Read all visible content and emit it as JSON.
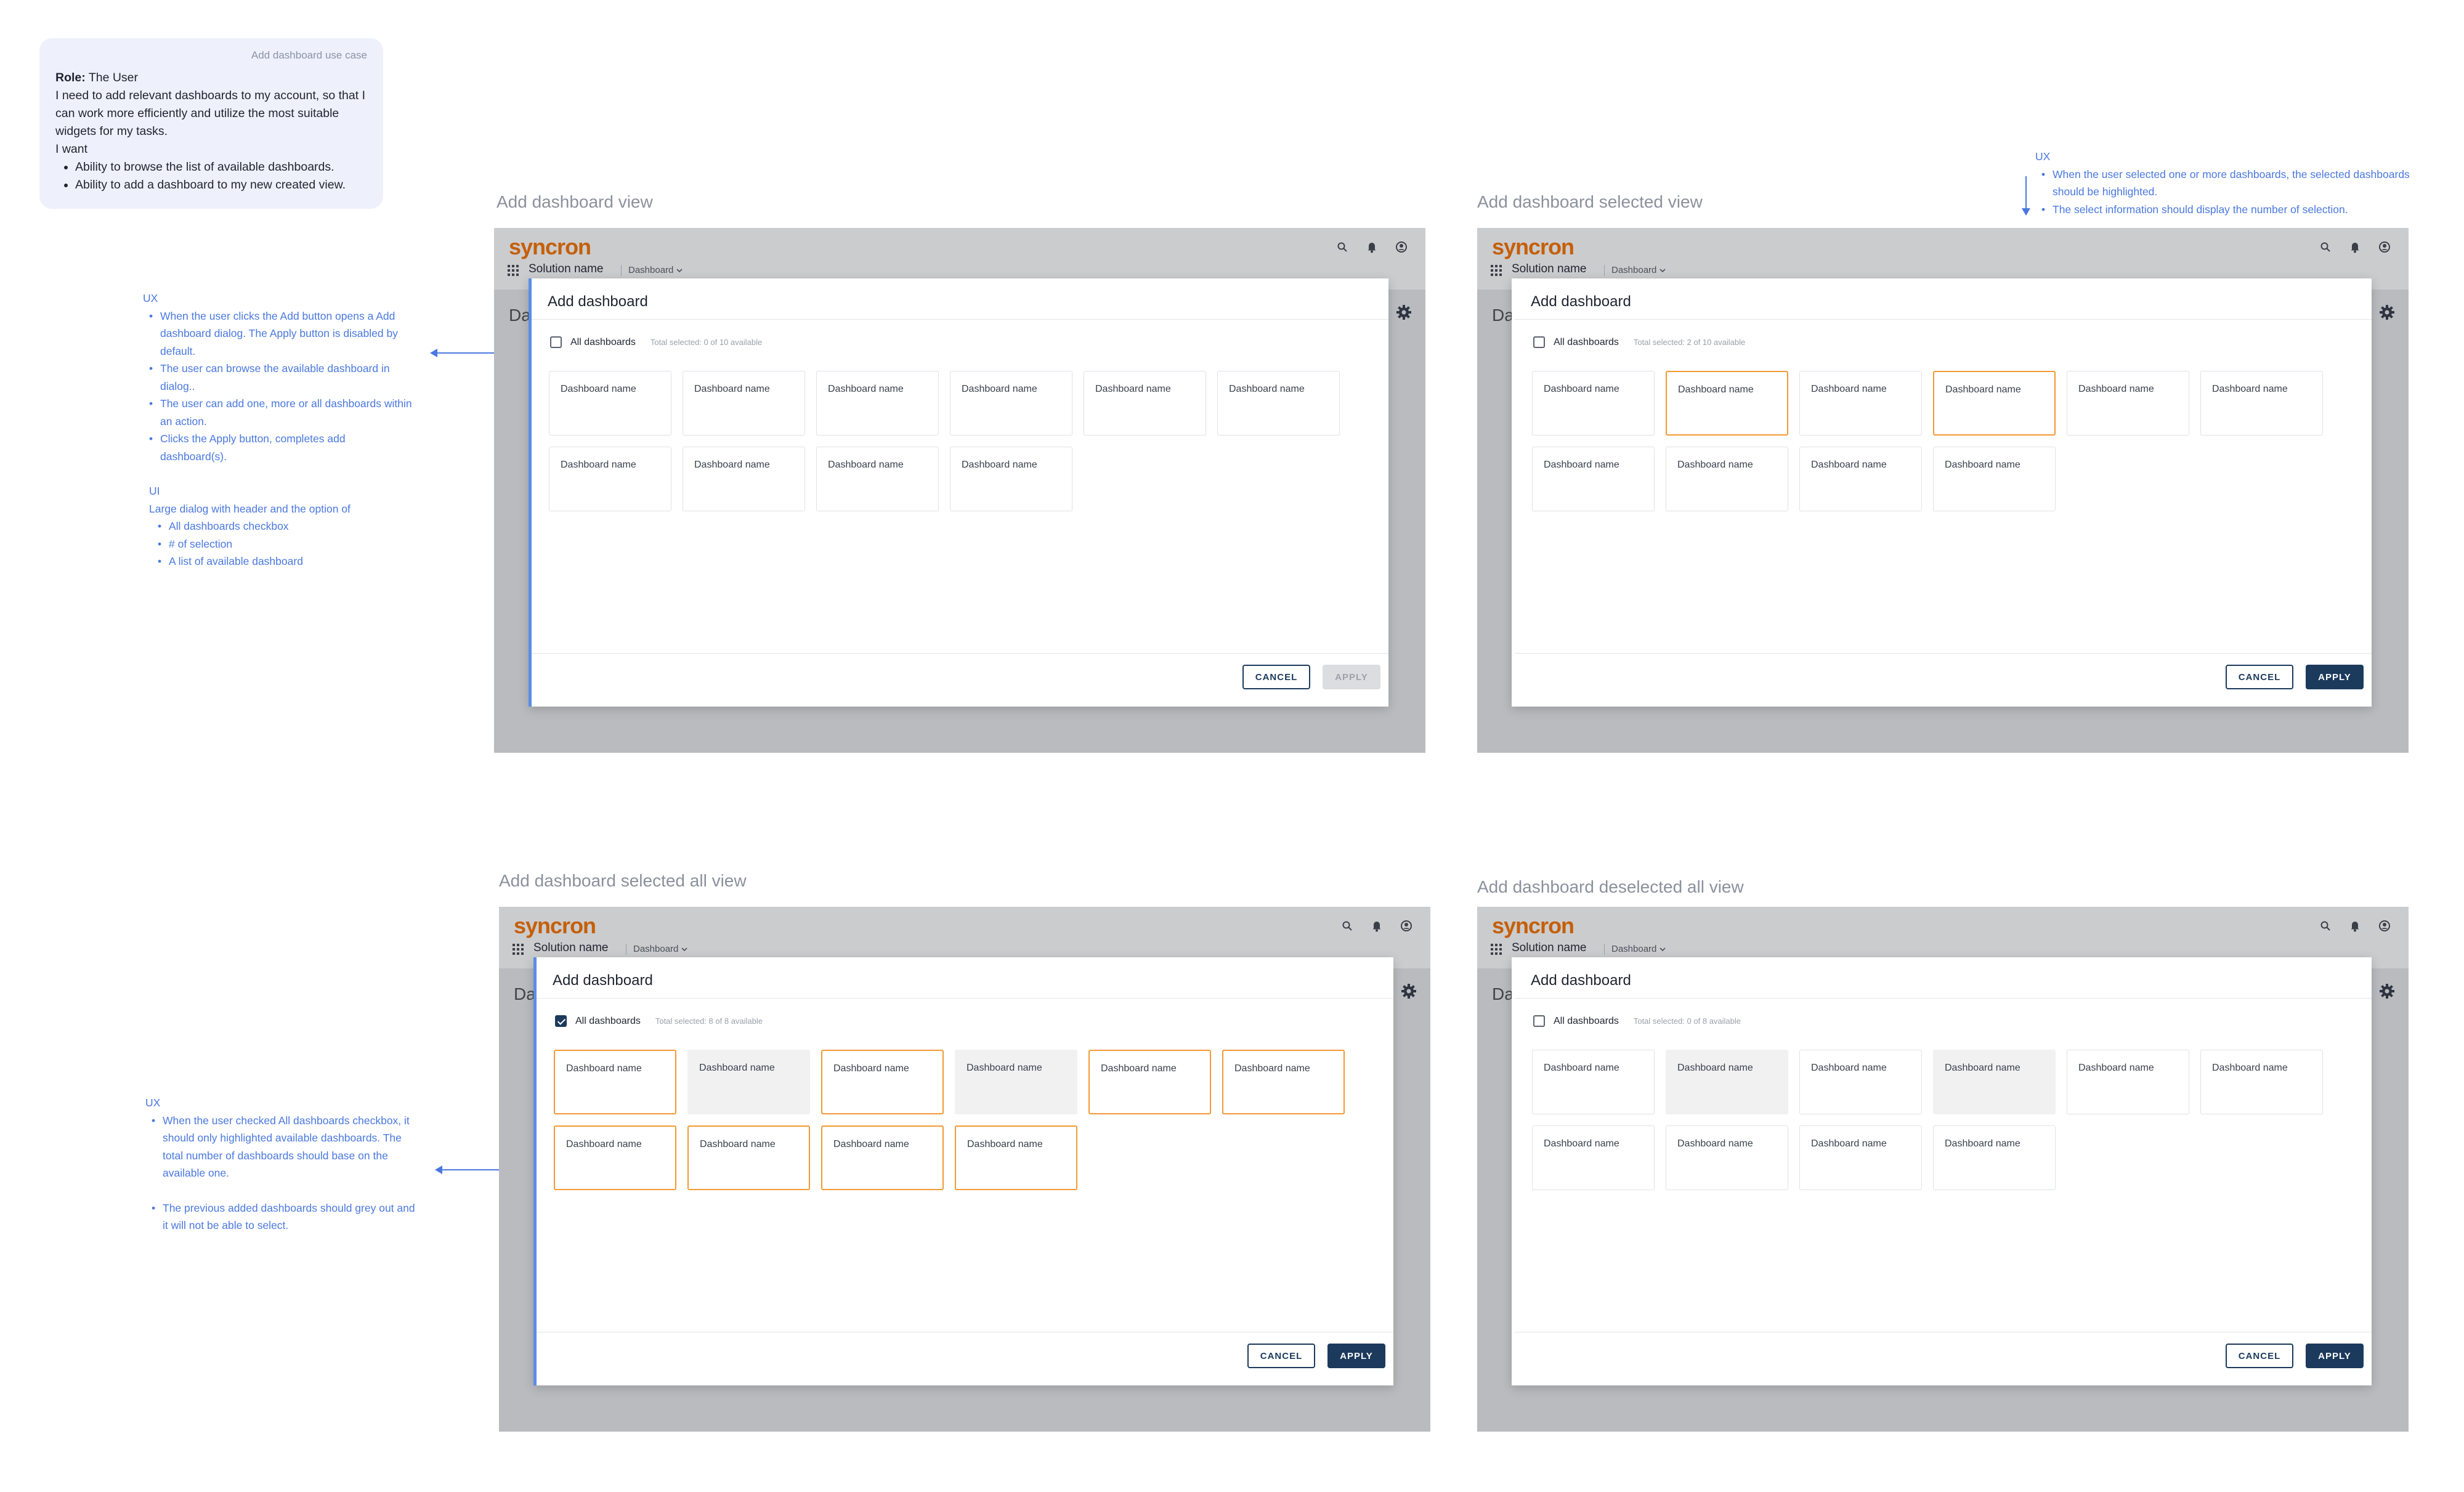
{
  "usecase": {
    "title": "Add dashboard use case",
    "role_label": "Role:",
    "role_value": " The User",
    "need": "I need to add relevant dashboards to my account, so that I can work more efficiently and utilize the most suitable widgets for my tasks.",
    "i_want": "I want",
    "wants": [
      "Ability to browse the list of available dashboards.",
      "Ability to add a dashboard to my new created view."
    ]
  },
  "notes": {
    "note1": {
      "ux_head": "UX",
      "ux_items": [
        "When the user clicks the Add button opens a Add dashboard dialog. The Apply button is disabled by default.",
        "The user can browse the available dashboard in dialog..",
        "The user can add one, more or all dashboards within an action.",
        "Clicks the Apply button, completes add dashboard(s)."
      ],
      "ui_head": "UI",
      "ui_text": "Large dialog with header and the option of",
      "ui_items": [
        "All dashboards checkbox",
        "# of selection",
        "A list of available dashboard"
      ]
    },
    "note2": {
      "ux_head": "UX",
      "ux_items": [
        "When the user selected one or more dashboards, the selected dashboards should be highlighted.",
        "The select information should display the number of selection."
      ]
    },
    "note3": {
      "ux_head": "UX",
      "ux_items": [
        "When the user checked All dashboards checkbox, it should only highlighted available dashboards. The total number of dashboards should base on the available one.",
        "The previous added dashboards should grey out and it will not be able to select."
      ]
    }
  },
  "app": {
    "logo": "syncron",
    "solution_name": "Solution name",
    "dashboard_menu": "Dashboard",
    "bg_letters": "Da"
  },
  "dialog_common": {
    "title": "Add dashboard",
    "all_label": "All dashboards",
    "card_label": "Dashboard name",
    "cancel": "CANCEL",
    "apply": "APPLY"
  },
  "views": [
    {
      "title": "Add dashboard view",
      "total": "Total selected: 0 of 10 available",
      "all_checked": false,
      "apply_disabled": true,
      "card_states": [
        "normal",
        "normal",
        "normal",
        "normal",
        "normal",
        "normal",
        "normal",
        "normal",
        "normal",
        "normal"
      ]
    },
    {
      "title": "Add dashboard selected view",
      "total": "Total selected: 2 of 10 available",
      "all_checked": false,
      "apply_disabled": false,
      "card_states": [
        "normal",
        "selected",
        "normal",
        "selected",
        "normal",
        "normal",
        "normal",
        "normal",
        "normal",
        "normal"
      ]
    },
    {
      "title": "Add dashboard selected all view",
      "total": "Total selected: 8 of 8 available",
      "all_checked": true,
      "apply_disabled": false,
      "card_states": [
        "selected",
        "disabled",
        "selected",
        "disabled",
        "selected",
        "selected",
        "selected",
        "selected",
        "selected",
        "selected"
      ]
    },
    {
      "title": "Add dashboard deselected all view",
      "total": "Total selected: 0 of 8 available",
      "all_checked": false,
      "apply_disabled": false,
      "card_states": [
        "normal",
        "disabled",
        "normal",
        "disabled",
        "normal",
        "normal",
        "normal",
        "normal",
        "normal",
        "normal"
      ]
    }
  ],
  "colors": {
    "brand": "#c65f06",
    "selected_border": "#f39a33",
    "primary_button": "#1b3a5c",
    "note_blue": "#4a78e0"
  }
}
